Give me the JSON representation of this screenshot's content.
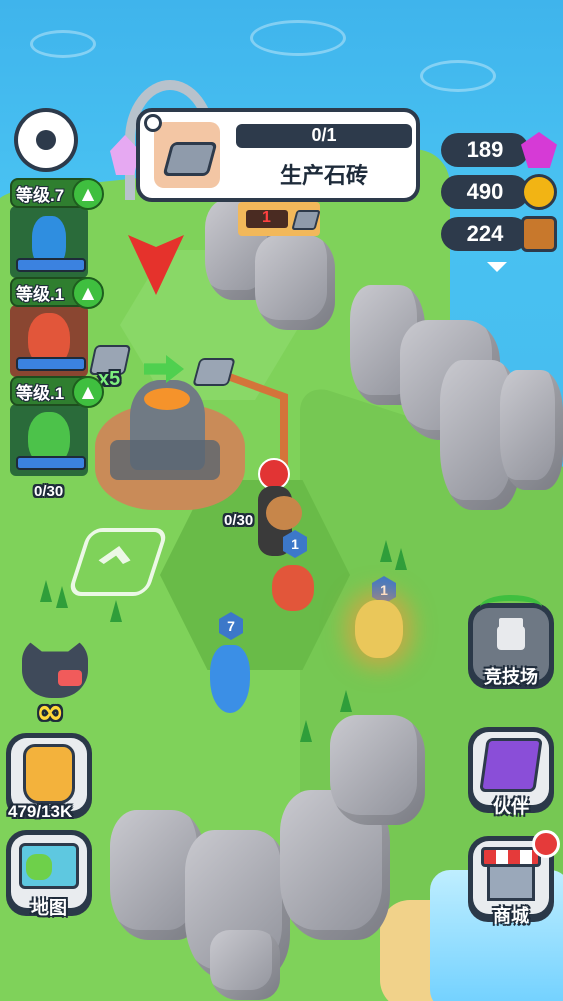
{
  "quest": {
    "progress_text": "0/1",
    "progress_fraction": 0,
    "title": "生产石砖",
    "item_icon": "stone-brick-icon"
  },
  "resources": [
    {
      "value": "189",
      "icon": "gem-icon",
      "color": "#d63ad6"
    },
    {
      "value": "490",
      "icon": "gold-coin-icon",
      "color": "#f2b414"
    },
    {
      "value": "224",
      "icon": "wood-log-icon",
      "color": "#c8782c"
    }
  ],
  "pets": [
    {
      "level_label": "等级.7",
      "name": "blue-snake",
      "color": "#2f8ee0"
    },
    {
      "level_label": "等级.1",
      "name": "fire-critter",
      "color": "#e2563a"
    },
    {
      "level_label": "等级.1",
      "name": "green-lizard",
      "color": "#4cc24a"
    }
  ],
  "pets_capacity": "0/30",
  "factory": {
    "counter": "0/30",
    "input_multiplier": "x5",
    "stock_count": "1"
  },
  "units": [
    {
      "level": "1"
    },
    {
      "level": "1"
    },
    {
      "level": "7"
    }
  ],
  "left_buttons": {
    "wolf_count": "∞",
    "backpack_label": "479/13K",
    "map_label": "地图"
  },
  "right_buttons": {
    "arena_label": "竞技场",
    "companion_label": "伙伴",
    "shop_label": "商城"
  },
  "colors": {
    "panel_dark": "#2d3a4b",
    "grass": "#7fd25a",
    "water": "#3fb4ec",
    "accent_green": "#3fbf3f",
    "pet_bar_blue": "#3b82e0"
  }
}
